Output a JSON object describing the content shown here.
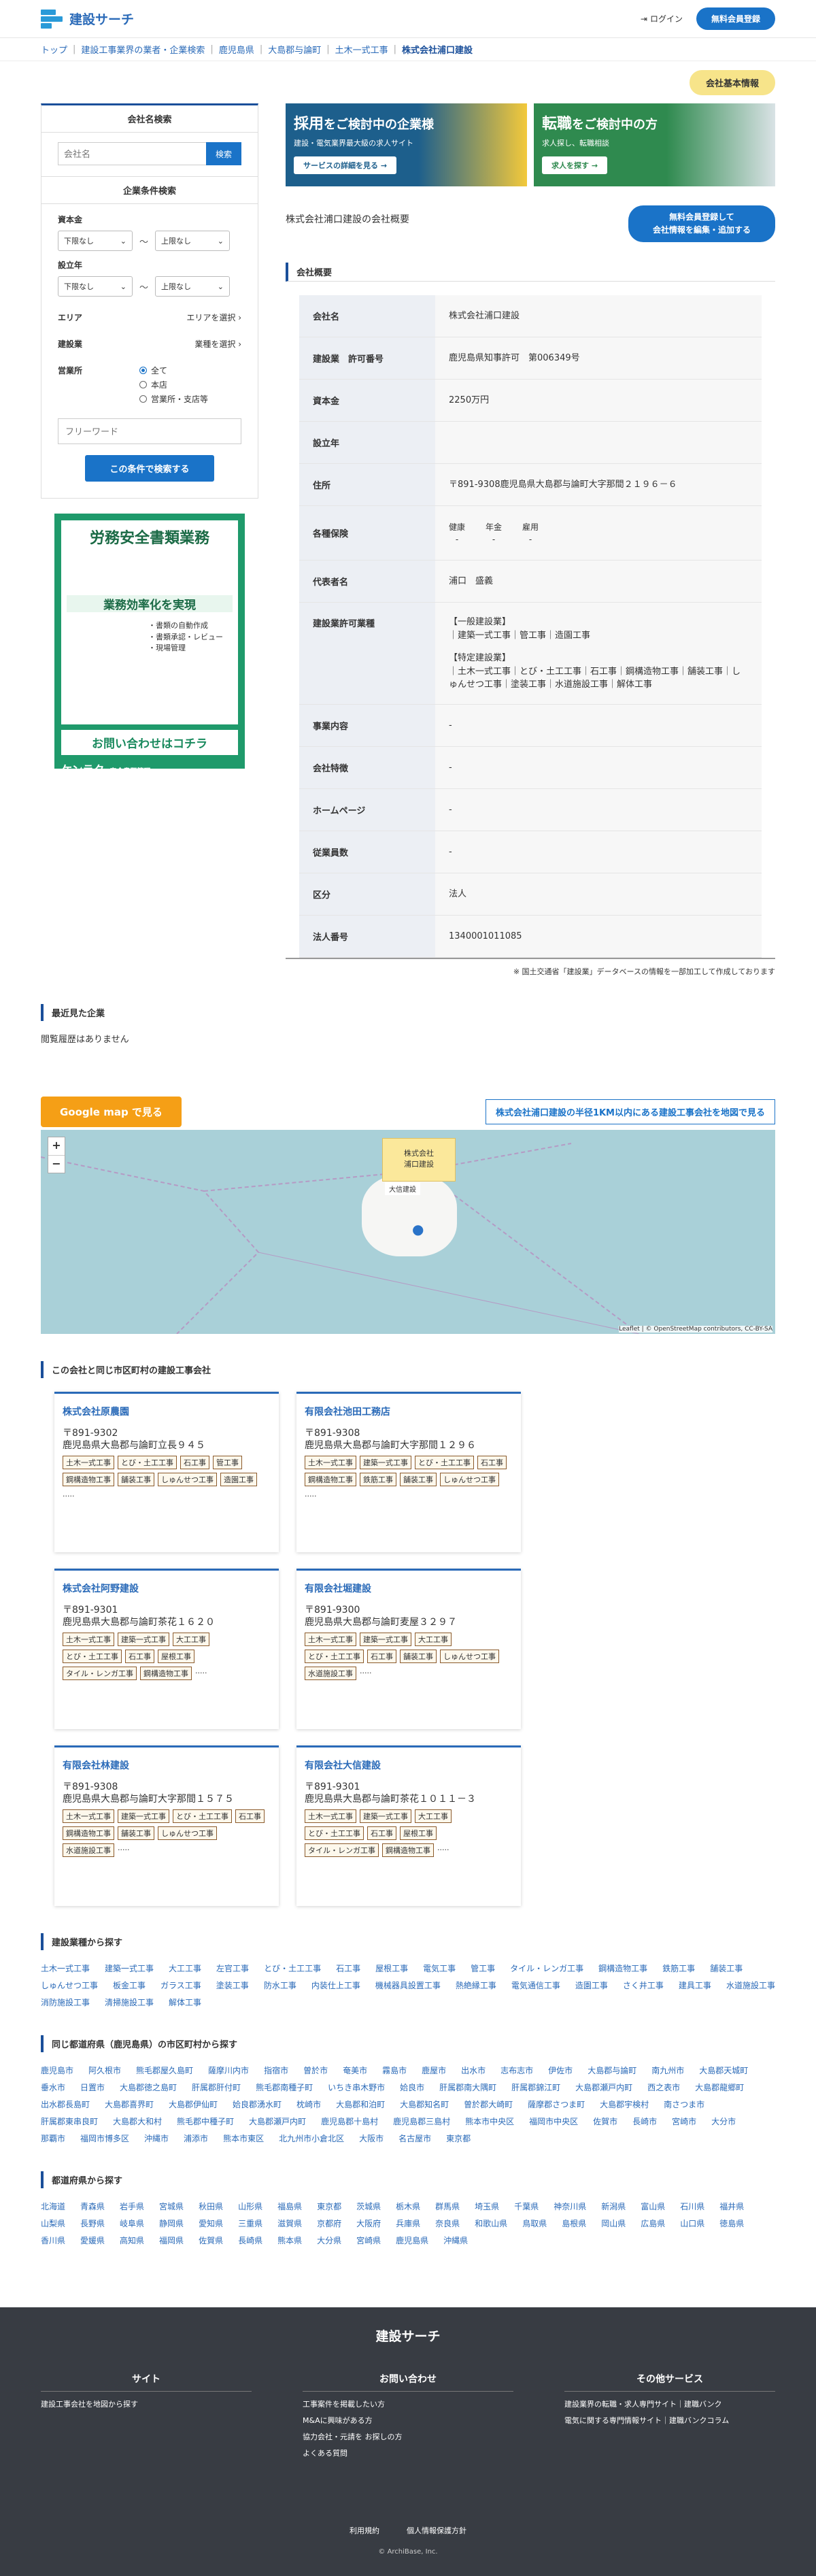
{
  "header": {
    "logo": "建設サーチ",
    "login": "ログイン",
    "register": "無料会員登録"
  },
  "breadcrumb": [
    "トップ",
    "建設工事業界の業者・企業検索",
    "鹿児島県",
    "大島郡与論町",
    "土木一式工事",
    "株式会社浦口建設"
  ],
  "tag": "会社基本情報",
  "sidebar": {
    "name_search_title": "会社名検索",
    "name_placeholder": "会社名",
    "search_btn": "検索",
    "cond_title": "企業条件検索",
    "capital": "資本金",
    "founded": "設立年",
    "lower": "下限なし",
    "upper": "上限なし",
    "tilde": "〜",
    "area": "エリア",
    "area_pick": "エリアを選択",
    "industry": "建設業",
    "industry_pick": "業種を選択",
    "office": "営業所",
    "radios": [
      "全て",
      "本店",
      "営業所・支店等"
    ],
    "free_placeholder": "フリーワード",
    "submit": "この条件で検索する"
  },
  "ad": {
    "title": "労務安全書類業務",
    "sub": "業務効率化を実現",
    "items": [
      "・書類の自動作成",
      "・書類承認・レビュー",
      "・現場管理"
    ],
    "cta": "お問い合わせはコチラ",
    "brand": "ケンラク",
    "brand_sub": "安全書類管理"
  },
  "banners": [
    {
      "t1": "採用",
      "t2": "をご検討中の企業様",
      "sub": "建設・電気業界最大級の求人サイト",
      "btn": "サービスの詳細を見る →"
    },
    {
      "t1": "転職",
      "t2": "をご検討中の方",
      "sub": "求人探し、転職相談",
      "btn": "求人を探す →"
    }
  ],
  "overview": {
    "title": "株式会社浦口建設の会社概要",
    "edit": [
      "無料会員登録して",
      "会社情報を編集・追加する"
    ],
    "section": "会社概要",
    "rows": [
      {
        "k": "会社名",
        "v": "株式会社浦口建設"
      },
      {
        "k": "建設業　許可番号",
        "v": "鹿児島県知事許可　第006349号"
      },
      {
        "k": "資本金",
        "v": "2250万円"
      },
      {
        "k": "設立年",
        "v": ""
      },
      {
        "k": "住所",
        "v": "〒891-9308鹿児島県大島郡与論町大字那間２１９６－６"
      }
    ],
    "insurance_key": "各種保険",
    "insurance": [
      {
        "n": "健康",
        "v": "-"
      },
      {
        "n": "年金",
        "v": "-"
      },
      {
        "n": "雇用",
        "v": "-"
      }
    ],
    "rows2": [
      {
        "k": "代表者名",
        "v": "浦口　盛義"
      }
    ],
    "license_key": "建設業許可業種",
    "license": [
      "【一般建設業】",
      "｜建築一式工事｜管工事｜造園工事",
      "",
      "【特定建設業】",
      "｜土木一式工事｜とび・土工工事｜石工事｜鋼構造物工事｜舗装工事｜しゅんせつ工事｜塗装工事｜水道施設工事｜解体工事"
    ],
    "rows3": [
      {
        "k": "事業内容",
        "v": "-"
      },
      {
        "k": "会社特徴",
        "v": "-"
      },
      {
        "k": "ホームページ",
        "v": "-"
      },
      {
        "k": "従業員数",
        "v": "-"
      },
      {
        "k": "区分",
        "v": "法人"
      },
      {
        "k": "法人番号",
        "v": "1340001011085"
      }
    ],
    "note": "※ 国土交通省「建設業」データベースの情報を一部加工して作成しております"
  },
  "recent": {
    "title": "最近見た企業",
    "empty": "閲覧履歴はありません"
  },
  "map": {
    "gmap": "Google map で見る",
    "link": "株式会社浦口建設の半径1KM以内にある建設工事会社を地図で見る",
    "popup": [
      "株式会社",
      "浦口建設"
    ],
    "label": "大信建設",
    "credit": "Leaflet | © OpenStreetMap contributors, CC-BY-SA"
  },
  "same_city": {
    "title": "この会社と同じ市区町村の建設工事会社",
    "cards": [
      {
        "name": "株式会社原農園",
        "zip": "〒891-9302",
        "addr": "鹿児島県大島郡与論町立長９４５",
        "chips": [
          "土木一式工事",
          "とび・土工工事",
          "石工事",
          "管工事",
          "鋼構造物工事",
          "舗装工事",
          "しゅんせつ工事",
          "造園工事"
        ]
      },
      {
        "name": "有限会社池田工務店",
        "zip": "〒891-9308",
        "addr": "鹿児島県大島郡与論町大字那間１２９６",
        "chips": [
          "土木一式工事",
          "建築一式工事",
          "とび・土工工事",
          "石工事",
          "鋼構造物工事",
          "鉄筋工事",
          "舗装工事",
          "しゅんせつ工事"
        ]
      },
      {
        "name": "株式会社阿野建設",
        "zip": "〒891-9301",
        "addr": "鹿児島県大島郡与論町茶花１６２０",
        "chips": [
          "土木一式工事",
          "建築一式工事",
          "大工工事",
          "とび・土工工事",
          "石工事",
          "屋根工事",
          "タイル・レンガ工事",
          "鋼構造物工事"
        ]
      },
      {
        "name": "有限会社堀建設",
        "zip": "〒891-9300",
        "addr": "鹿児島県大島郡与論町麦屋３２９７",
        "chips": [
          "土木一式工事",
          "建築一式工事",
          "大工工事",
          "とび・土工工事",
          "石工事",
          "舗装工事",
          "しゅんせつ工事",
          "水道施設工事"
        ]
      },
      {
        "name": "有限会社林建設",
        "zip": "〒891-9308",
        "addr": "鹿児島県大島郡与論町大字那間１５７５",
        "chips": [
          "土木一式工事",
          "建築一式工事",
          "とび・土工工事",
          "石工事",
          "鋼構造物工事",
          "舗装工事",
          "しゅんせつ工事",
          "水道施設工事"
        ]
      },
      {
        "name": "有限会社大信建設",
        "zip": "〒891-9301",
        "addr": "鹿児島県大島郡与論町茶花１０１１－３",
        "chips": [
          "土木一式工事",
          "建築一式工事",
          "大工工事",
          "とび・土工工事",
          "石工事",
          "屋根工事",
          "タイル・レンガ工事",
          "鋼構造物工事"
        ]
      }
    ],
    "more": "....."
  },
  "industries": {
    "title": "建設業種から探す",
    "items": [
      "土木一式工事",
      "建築一式工事",
      "大工工事",
      "左官工事",
      "とび・土工工事",
      "石工事",
      "屋根工事",
      "電気工事",
      "管工事",
      "タイル・レンガ工事",
      "鋼構造物工事",
      "鉄筋工事",
      "舗装工事",
      "しゅんせつ工事",
      "板金工事",
      "ガラス工事",
      "塗装工事",
      "防水工事",
      "内装仕上工事",
      "機械器具設置工事",
      "熱絶縁工事",
      "電気通信工事",
      "造園工事",
      "さく井工事",
      "建具工事",
      "水道施設工事",
      "消防施設工事",
      "清掃施設工事",
      "解体工事"
    ]
  },
  "cities": {
    "title": "同じ都道府県（鹿児島県）の市区町村から探す",
    "items": [
      "鹿児島市",
      "阿久根市",
      "熊毛郡屋久島町",
      "薩摩川内市",
      "指宿市",
      "曽於市",
      "奄美市",
      "霧島市",
      "鹿屋市",
      "出水市",
      "志布志市",
      "伊佐市",
      "大島郡与論町",
      "南九州市",
      "大島郡天城町",
      "垂水市",
      "日置市",
      "大島郡徳之島町",
      "肝属郡肝付町",
      "熊毛郡南種子町",
      "いちき串木野市",
      "姶良市",
      "肝属郡南大隅町",
      "肝属郡錦江町",
      "大島郡瀬戸内町",
      "西之表市",
      "大島郡龍郷町",
      "出水郡長島町",
      "大島郡喜界町",
      "大島郡伊仙町",
      "姶良郡湧水町",
      "枕崎市",
      "大島郡和泊町",
      "大島郡知名町",
      "曽於郡大崎町",
      "薩摩郡さつま町",
      "大島郡宇検村",
      "南さつま市",
      "肝属郡東串良町",
      "大島郡大和村",
      "熊毛郡中種子町",
      "大島郡瀬戸内町",
      "鹿児島郡十島村",
      "鹿児島郡三島村",
      "熊本市中央区",
      "福岡市中央区",
      "佐賀市",
      "長崎市",
      "宮崎市",
      "大分市",
      "那覇市",
      "福岡市博多区",
      "沖縄市",
      "浦添市",
      "熊本市東区",
      "北九州市小倉北区",
      "大阪市",
      "名古屋市",
      "東京都"
    ]
  },
  "prefs": {
    "title": "都道府県から探す",
    "items": [
      "北海道",
      "青森県",
      "岩手県",
      "宮城県",
      "秋田県",
      "山形県",
      "福島県",
      "東京都",
      "茨城県",
      "栃木県",
      "群馬県",
      "埼玉県",
      "千葉県",
      "神奈川県",
      "新潟県",
      "富山県",
      "石川県",
      "福井県",
      "山梨県",
      "長野県",
      "岐阜県",
      "静岡県",
      "愛知県",
      "三重県",
      "滋賀県",
      "京都府",
      "大阪府",
      "兵庫県",
      "奈良県",
      "和歌山県",
      "鳥取県",
      "島根県",
      "岡山県",
      "広島県",
      "山口県",
      "徳島県",
      "香川県",
      "愛媛県",
      "高知県",
      "福岡県",
      "佐賀県",
      "長崎県",
      "熊本県",
      "大分県",
      "宮崎県",
      "鹿児島県",
      "沖縄県"
    ]
  },
  "footer": {
    "title": "建設サーチ",
    "cols": [
      {
        "h": "サイト",
        "items": [
          "建設工事会社を地図から探す"
        ]
      },
      {
        "h": "お問い合わせ",
        "items": [
          "工事案件を掲載したい方",
          "M&Aに興味がある方",
          "協力会社・元請を お探しの方",
          "よくある質問"
        ]
      },
      {
        "h": "その他サービス",
        "items": [
          "建設業界の転職・求人専門サイト｜建職バンク",
          "電気に関する専門情報サイト｜建職バンクコラム"
        ]
      }
    ],
    "terms": "利用規約",
    "privacy": "個人情報保護方針",
    "copy": "© ArchiBase, Inc."
  }
}
